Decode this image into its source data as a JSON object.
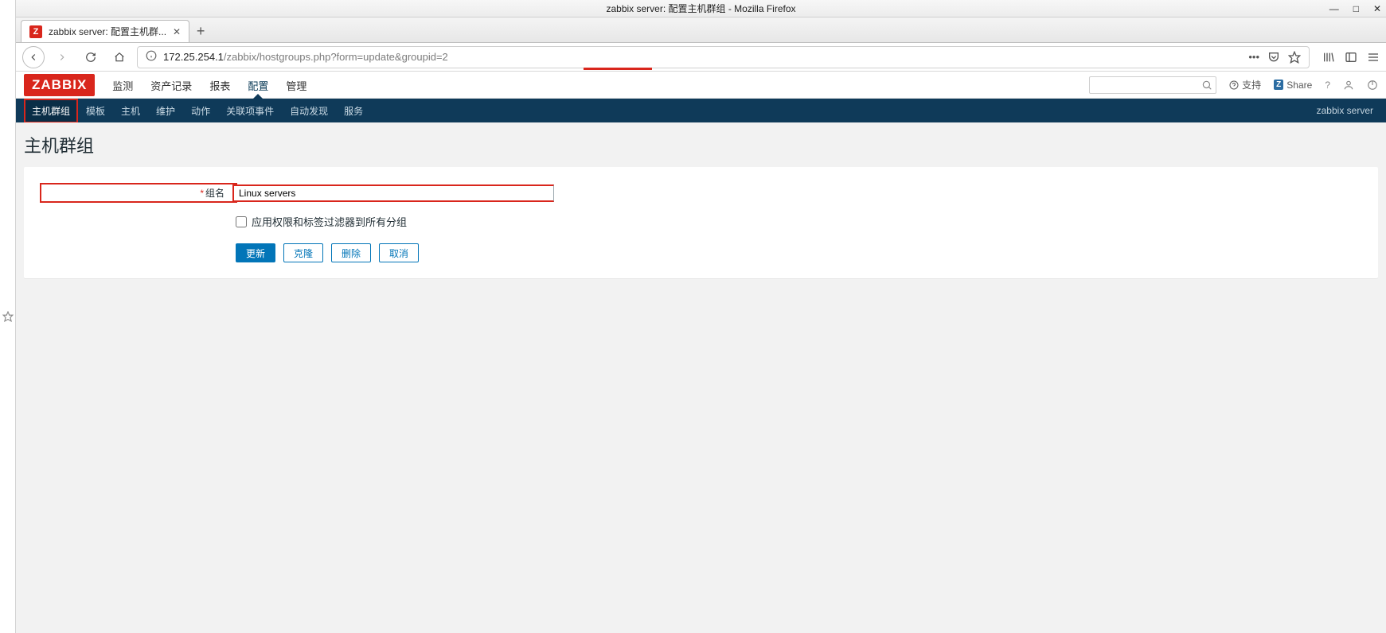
{
  "os": {
    "window_title": "zabbix server: 配置主机群组 - Mozilla Firefox"
  },
  "browser": {
    "tab_title": "zabbix server: 配置主机群...",
    "url_host": "172.25.254.1",
    "url_path": "/zabbix/hostgroups.php?form=update&groupid=2"
  },
  "zabbix": {
    "logo": "ZABBIX",
    "mainnav": {
      "items": [
        "监测",
        "资产记录",
        "报表",
        "配置",
        "管理"
      ],
      "active_index": 3
    },
    "topright": {
      "support": "支持",
      "share": "Share"
    },
    "subnav": {
      "items": [
        "主机群组",
        "模板",
        "主机",
        "维护",
        "动作",
        "关联项事件",
        "自动发现",
        "服务"
      ],
      "active_index": 0,
      "server_label": "zabbix server"
    }
  },
  "page": {
    "title": "主机群组",
    "form": {
      "name_label": "组名",
      "name_value": "Linux servers",
      "apply_label": "应用权限和标签过滤器到所有分组",
      "buttons": {
        "update": "更新",
        "clone": "克隆",
        "delete": "删除",
        "cancel": "取消"
      }
    }
  }
}
